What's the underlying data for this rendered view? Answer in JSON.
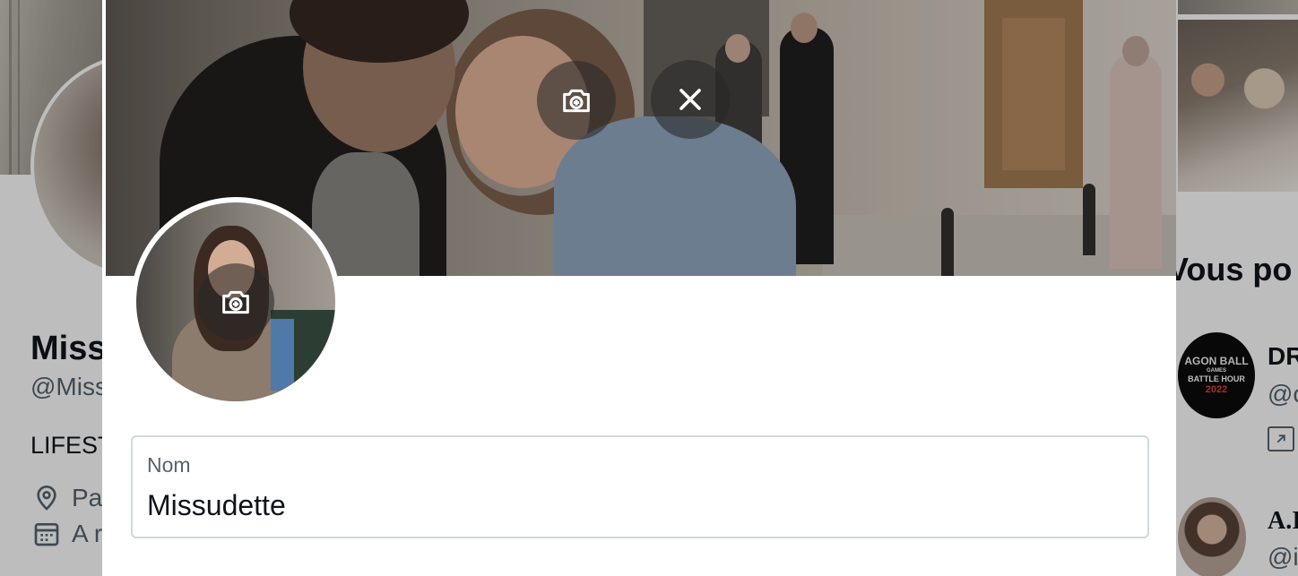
{
  "background_profile": {
    "name": "Miss",
    "handle": "@Miss",
    "bio": "LIFEST",
    "location": "Pa",
    "joined": "A r"
  },
  "background_sidebar": {
    "heading": "Vous po",
    "suggestions": [
      {
        "avatar_text": [
          "AGON BALL",
          "GAMES",
          "BATTLE HOUR",
          "2022"
        ],
        "name": "DR",
        "handle": "@c"
      },
      {
        "name": "A.I",
        "handle": "@i"
      }
    ]
  },
  "modal": {
    "banner": {
      "camera_icon": "camera-plus-icon",
      "close_icon": "close-icon"
    },
    "avatar": {
      "camera_icon": "camera-plus-icon"
    },
    "name_field": {
      "label": "Nom",
      "value": "Missudette"
    }
  },
  "colors": {
    "text_primary": "#0f1419",
    "text_secondary": "#536471",
    "field_border": "#cfd9de",
    "overlay": "rgba(0,0,0,0.26)"
  }
}
